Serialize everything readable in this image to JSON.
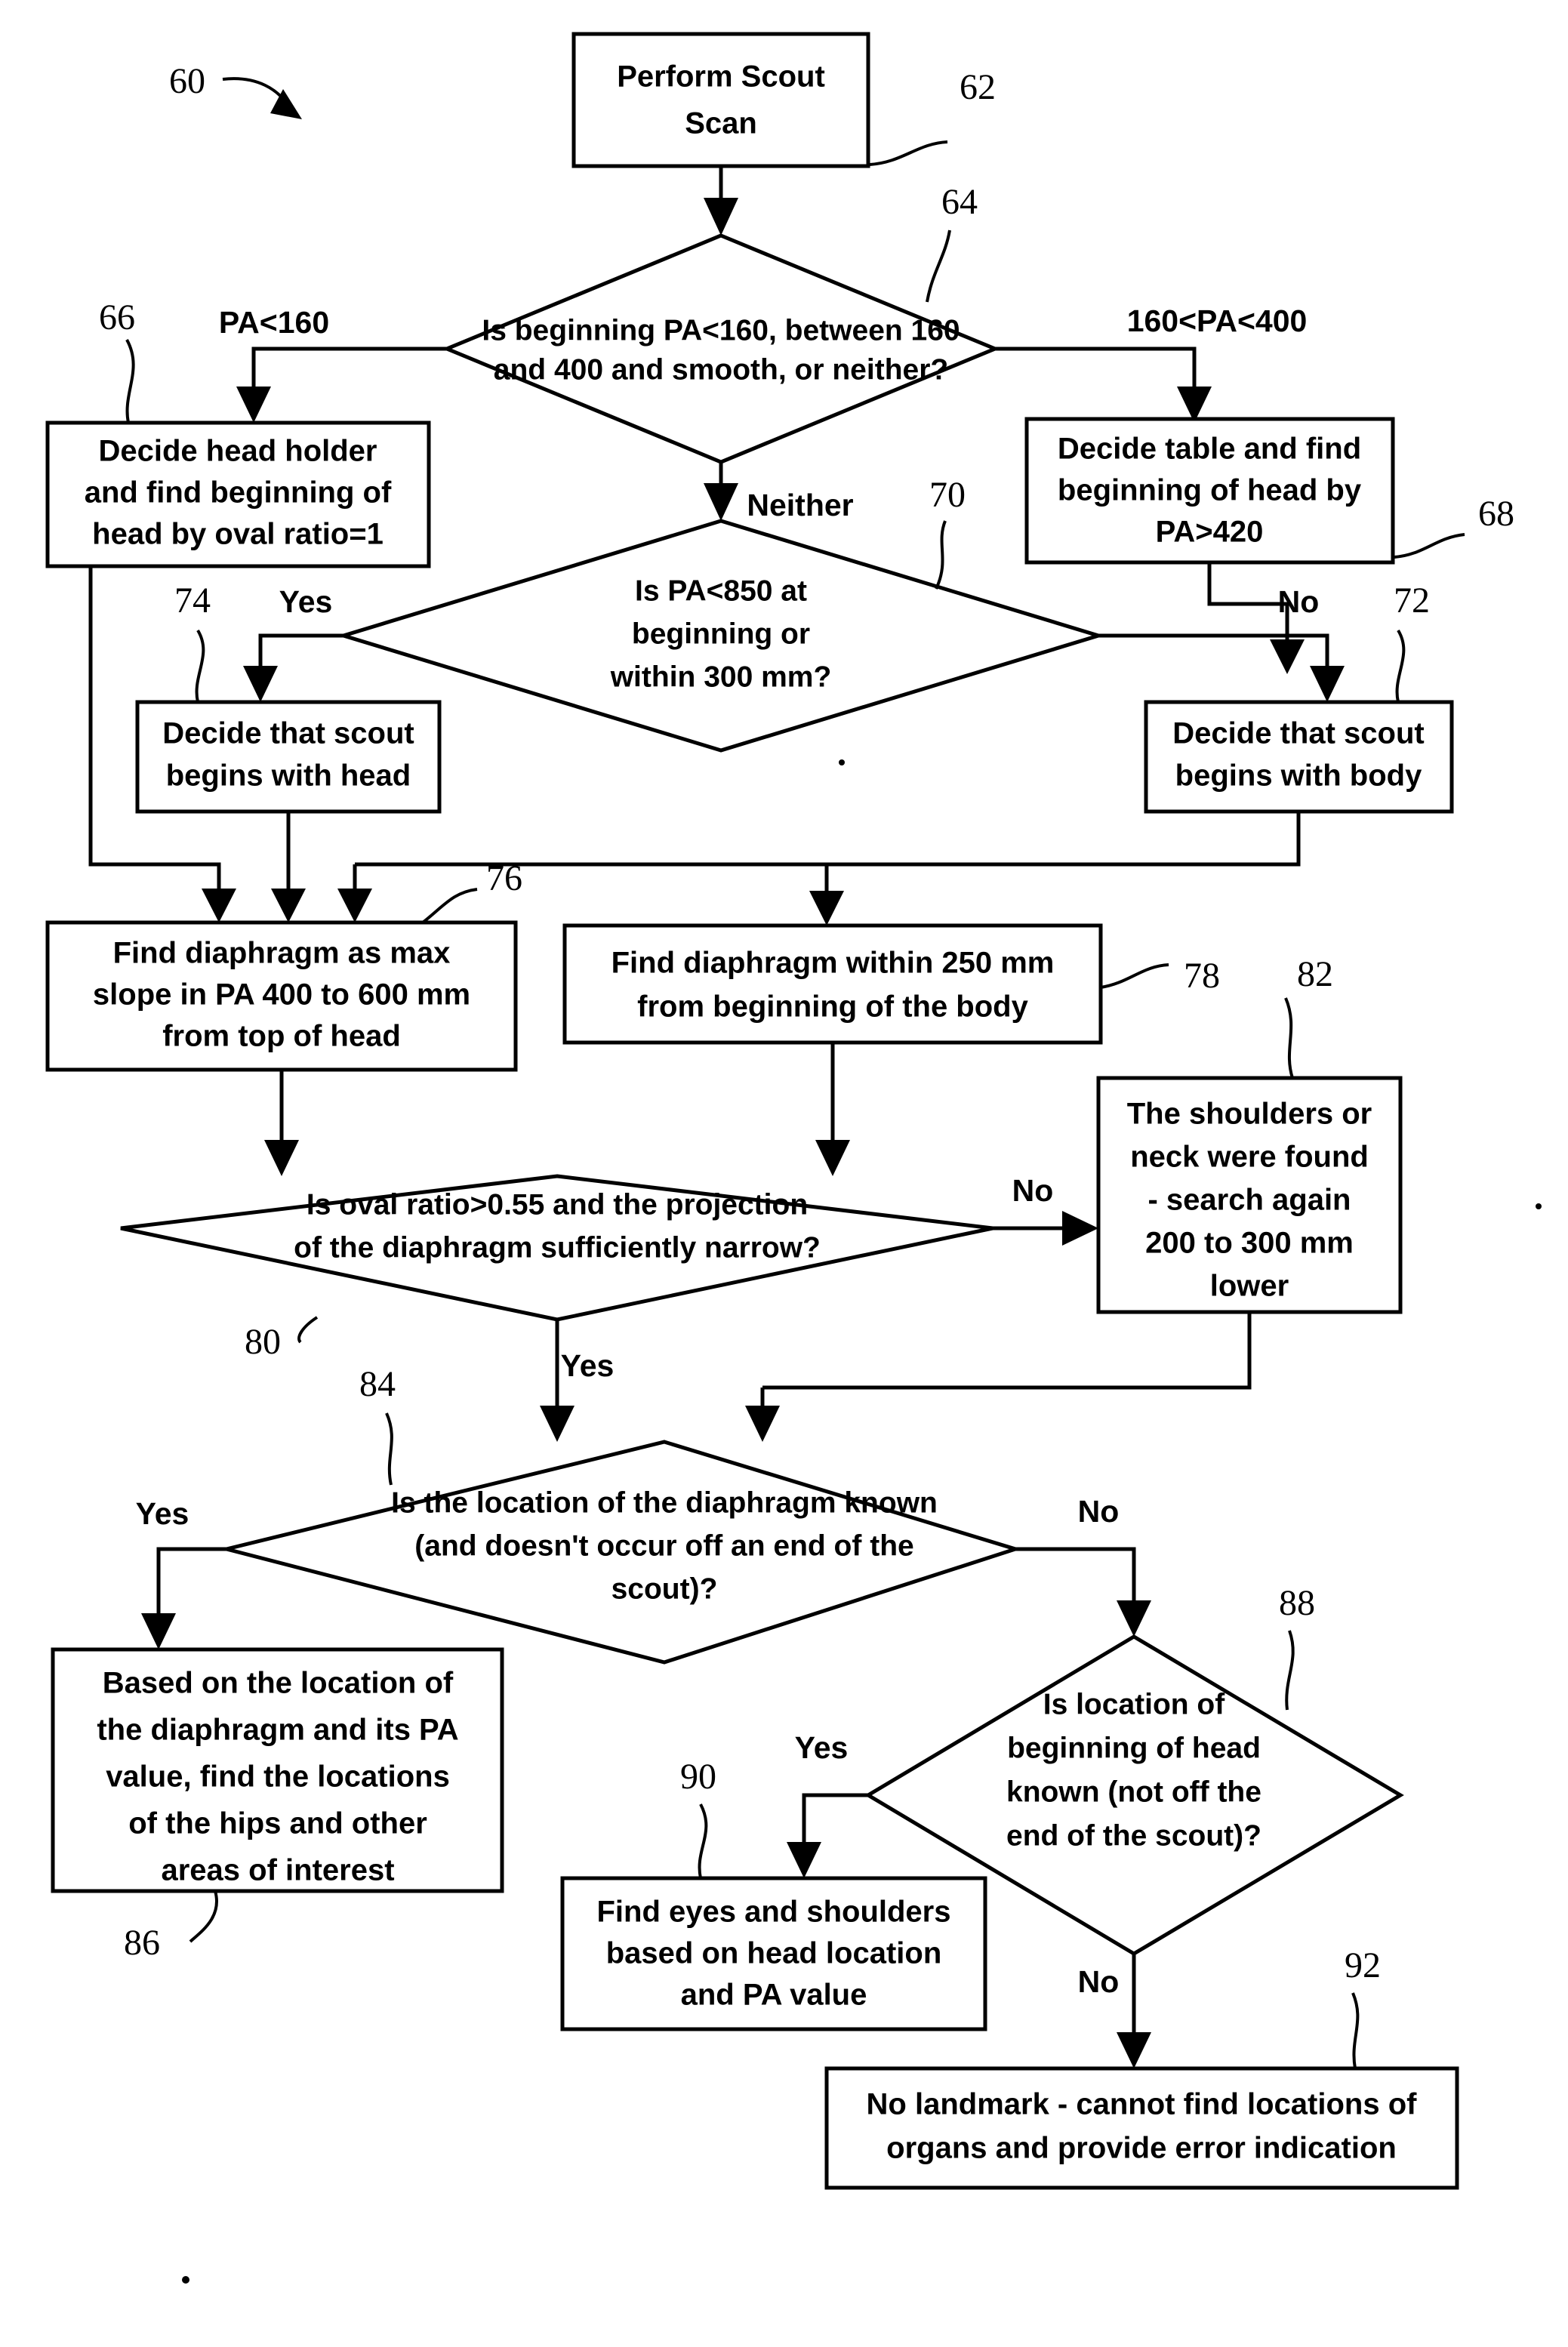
{
  "figure": {
    "reference_label": "60",
    "type": "flowchart"
  },
  "nodes": {
    "n62": {
      "ref": "62",
      "shape": "process",
      "lines": [
        "Perform Scout",
        "Scan"
      ]
    },
    "n64": {
      "ref": "64",
      "shape": "decision",
      "lines": [
        "Is beginning PA<160, between 160",
        "and 400 and smooth, or neither?"
      ]
    },
    "n66": {
      "ref": "66",
      "shape": "process",
      "lines": [
        "Decide head holder",
        "and find beginning of",
        "head by oval ratio=1"
      ]
    },
    "n68": {
      "ref": "68",
      "shape": "process",
      "lines": [
        "Decide table and find",
        "beginning of head by",
        "PA>420"
      ]
    },
    "n70": {
      "ref": "70",
      "shape": "decision",
      "lines": [
        "Is PA<850 at",
        "beginning or",
        "within 300 mm?"
      ]
    },
    "n72": {
      "ref": "72",
      "shape": "process",
      "lines": [
        "Decide that scout",
        "begins with body"
      ]
    },
    "n74": {
      "ref": "74",
      "shape": "process",
      "lines": [
        "Decide that scout",
        "begins with head"
      ]
    },
    "n76": {
      "ref": "76",
      "shape": "process",
      "lines": [
        "Find diaphragm as max",
        "slope in PA 400 to 600 mm",
        "from top of head"
      ]
    },
    "n78": {
      "ref": "78",
      "shape": "process",
      "lines": [
        "Find diaphragm within 250 mm",
        "from beginning of the body"
      ]
    },
    "n80": {
      "ref": "80",
      "shape": "decision",
      "lines": [
        "Is oval ratio>0.55 and the projection",
        "of the diaphragm sufficiently narrow?"
      ]
    },
    "n82": {
      "ref": "82",
      "shape": "process",
      "lines": [
        "The shoulders or",
        "neck were found",
        "- search again",
        "200 to 300 mm",
        "lower"
      ]
    },
    "n84": {
      "ref": "84",
      "shape": "decision",
      "lines": [
        "Is the location of the diaphragm known",
        "(and doesn't occur off an end of the",
        "scout)?"
      ]
    },
    "n86": {
      "ref": "86",
      "shape": "process",
      "lines": [
        "Based on the location of",
        "the diaphragm and its PA",
        "value, find the locations",
        "of the hips and other",
        "areas of interest"
      ]
    },
    "n88": {
      "ref": "88",
      "shape": "decision",
      "lines": [
        "Is location of",
        "beginning of head",
        "known (not off the",
        "end of the scout)?"
      ]
    },
    "n90": {
      "ref": "90",
      "shape": "process",
      "lines": [
        "Find eyes and shoulders",
        "based on head location",
        "and PA value"
      ]
    },
    "n92": {
      "ref": "92",
      "shape": "process",
      "lines": [
        "No landmark - cannot find locations of",
        "organs and provide error indication"
      ]
    }
  },
  "edge_labels": {
    "pa_lt_160": "PA<160",
    "pa_160_400": "160<PA<400",
    "neither": "Neither",
    "yes_70": "Yes",
    "no_70": "No",
    "no_80": "No",
    "yes_80": "Yes",
    "yes_84": "Yes",
    "no_84": "No",
    "yes_88": "Yes",
    "no_88": "No"
  },
  "colors": {
    "ink": "#000000",
    "paper": "#ffffff"
  }
}
